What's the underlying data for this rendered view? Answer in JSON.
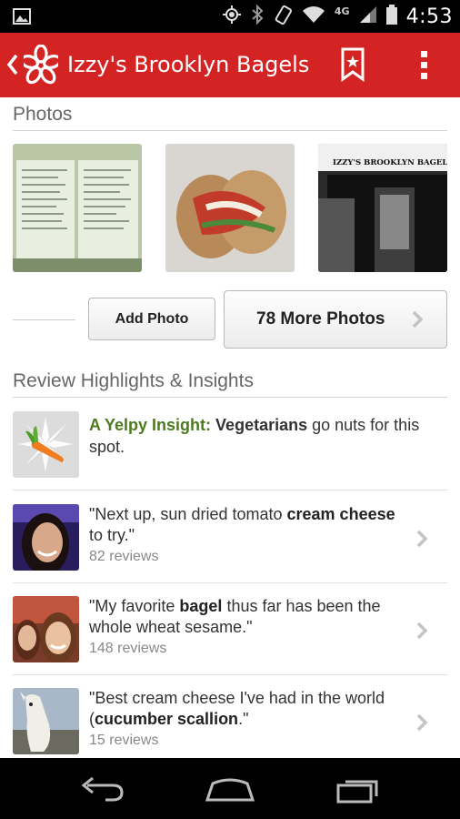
{
  "status_bar": {
    "network": "4G",
    "time": "4:53"
  },
  "header": {
    "title": "Izzy's Brooklyn Bagels",
    "brand_color": "#d32323"
  },
  "photos": {
    "section_title": "Photos",
    "storefront_sign": "IZZY'S BROOKLYN BAGELS",
    "add_photo_label": "Add Photo",
    "more_photos_label": "78 More Photos"
  },
  "highlights": {
    "section_title": "Review Highlights & Insights",
    "insight": {
      "label": "A Yelpy Insight:",
      "keyword": "Vegetarians",
      "text": "go nuts for this spot.",
      "label_color": "#4c7a1e"
    },
    "reviews": [
      {
        "pre": "\"Next up, sun dried tomato ",
        "bold": "cream cheese",
        "post": " to try.\"",
        "count": "82 reviews"
      },
      {
        "pre": "\"My favorite ",
        "bold": "bagel",
        "post": " thus far has been the whole wheat sesame.\"",
        "count": "148 reviews"
      },
      {
        "pre": "\"Best cream cheese I've had in the world (",
        "bold": "cucumber scallion",
        "post": ".\"",
        "count": "15 reviews"
      }
    ]
  }
}
